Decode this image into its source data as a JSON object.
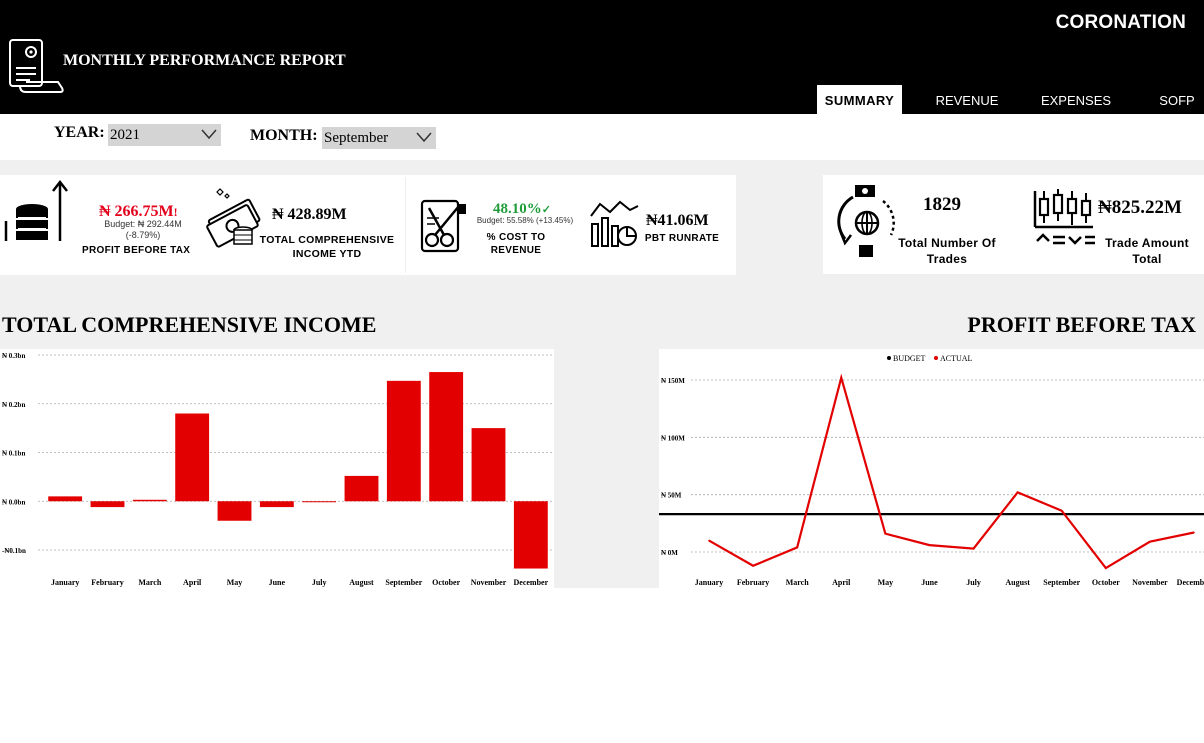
{
  "header": {
    "brand": "CORONATION",
    "title": "MONTHLY PERFORMANCE REPORT",
    "tabs": [
      {
        "label": "SUMMARY",
        "active": true
      },
      {
        "label": "REVENUE",
        "active": false
      },
      {
        "label": "EXPENSES",
        "active": false
      },
      {
        "label": "SOFP",
        "active": false
      }
    ]
  },
  "filters": {
    "year_label": "YEAR:",
    "year_value": "2021",
    "month_label": "MONTH:",
    "month_value": "September"
  },
  "kpis": {
    "pbt": {
      "value": "₦ 266.75M",
      "flag": "!",
      "budget": "Budget: ₦ 292.44M",
      "variance": "(-8.79%)",
      "label": "PROFIT BEFORE TAX",
      "icon": "coin-stack-up-icon"
    },
    "tci": {
      "value": "₦ 428.89M",
      "label_line1": "TOTAL COMPREHENSIVE",
      "label_line2": "INCOME YTD",
      "icon": "cash-money-icon"
    },
    "ctr": {
      "value": "48.10%",
      "check": "✓",
      "budget": "Budget: 55.58% (+13.45%)",
      "label_line1": "% COST TO",
      "label_line2": "REVENUE",
      "icon": "cost-cut-icon"
    },
    "pbt_runrate": {
      "value": "₦41.06M",
      "label": "PBT RUNRATE",
      "icon": "bar-chart-growth-icon"
    },
    "trades": {
      "value": "1829",
      "label_line1": "Total Number Of",
      "label_line2": "Trades",
      "icon": "global-trade-icon"
    },
    "trade_amount": {
      "value": "₦825.22M",
      "label_line1": "Trade Amount",
      "label_line2": "Total",
      "icon": "candlestick-icon"
    }
  },
  "colors": {
    "accent_red": "#e30000",
    "kpi_red": "#e3001b",
    "kpi_green": "#1f9d3a",
    "budget_line": "#000000"
  },
  "charts": {
    "tci_title": "TOTAL COMPREHENSIVE INCOME",
    "pbt_title": "PROFIT BEFORE TAX"
  },
  "chart_data": [
    {
      "type": "bar",
      "title": "TOTAL COMPREHENSIVE INCOME",
      "categories": [
        "January",
        "February",
        "March",
        "April",
        "May",
        "June",
        "July",
        "August",
        "September",
        "October",
        "November",
        "December"
      ],
      "values": [
        0.01,
        -0.012,
        0.003,
        0.18,
        -0.04,
        -0.012,
        -0.002,
        0.052,
        0.247,
        0.265,
        0.15,
        -0.138
      ],
      "yticks": [
        "₦ 0.3bn",
        "₦ 0.2bn",
        "₦ 0.1bn",
        "₦ 0.0bn",
        "-₦0.1bn"
      ],
      "ylim": [
        -0.1,
        0.3
      ],
      "grid": true
    },
    {
      "type": "line",
      "title": "PROFIT BEFORE TAX",
      "categories": [
        "January",
        "February",
        "March",
        "April",
        "May",
        "June",
        "July",
        "August",
        "September",
        "October",
        "November",
        "December"
      ],
      "series": [
        {
          "name": "BUDGET",
          "values": [
            33,
            33,
            33,
            33,
            33,
            33,
            33,
            33,
            33,
            33,
            33,
            33
          ]
        },
        {
          "name": "ACTUAL",
          "values": [
            10,
            -12,
            4,
            152,
            16,
            6,
            3,
            52,
            36,
            -14,
            9,
            17
          ]
        }
      ],
      "yticks": [
        "₦ 150M",
        "₦ 100M",
        "₦ 50M",
        "₦ 0M"
      ],
      "ylim": [
        0,
        150
      ],
      "legend": "top-center",
      "grid": true
    }
  ]
}
